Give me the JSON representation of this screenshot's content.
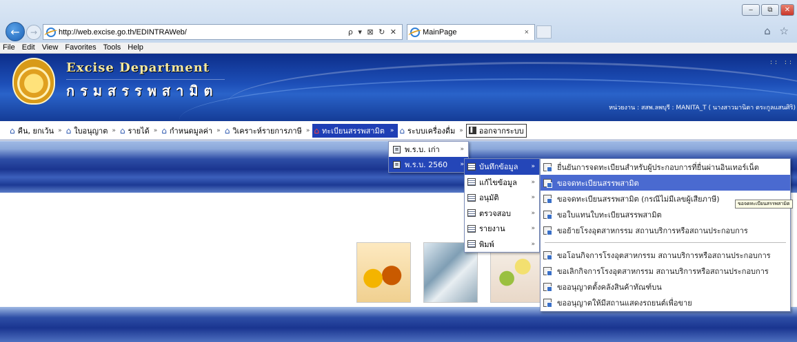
{
  "browser": {
    "url": "http://web.excise.go.th/EDINTRAWeb/",
    "url_tools": "ρ ▾ ⊠ ↻ ✕",
    "tab_title": "MainPage",
    "tab_close": "×",
    "caption_buttons": [
      "‒",
      "⧉",
      "✕"
    ],
    "toolbar_icons": "⌂ ☆"
  },
  "menubar": [
    "File",
    "Edit",
    "View",
    "Favorites",
    "Tools",
    "Help"
  ],
  "banner": {
    "title_en": "Excise Department",
    "title_th": "กรมสรรพสามิต",
    "user_info": "หน่วยงาน : สสพ.ลพบุรี : MANITA_T ( นางสาวมานิตา ตระกูลแสนศิริ)",
    "dots": ":: ::"
  },
  "main_menu": [
    {
      "label": "คืน, ยกเว้น"
    },
    {
      "label": "ใบอนุญาต"
    },
    {
      "label": "รายได้"
    },
    {
      "label": "กำหนดมูลค่า"
    },
    {
      "label": "วิเคราะห์รายการภาษี"
    },
    {
      "label": "ทะเบียนสรรพสามิต"
    },
    {
      "label": "ระบบเครื่องดื่ม"
    },
    {
      "label": "ออกจากระบบ"
    }
  ],
  "menu_separator": "»",
  "active_separator": "»",
  "submenu1": [
    {
      "label": "พ.ร.บ. เก่า"
    },
    {
      "label": "พ.ร.บ. 2560"
    }
  ],
  "submenu2": [
    {
      "label": "บันทึกข้อมูล"
    },
    {
      "label": "แก้ไขข้อมูล"
    },
    {
      "label": "อนุมัติ"
    },
    {
      "label": "ตรวจสอบ"
    },
    {
      "label": "รายงาน"
    },
    {
      "label": "พิมพ์"
    }
  ],
  "submenu3": [
    {
      "label": "ยื่นยันการจดทะเบียนสำหรับผู้ประกอบการที่ยื่นผ่านอินเทอร์เน็ต"
    },
    {
      "label": "ขอจดทะเบียนสรรพสามิต"
    },
    {
      "label": "ขอจดทะเบียนสรรพสามิต (กรณีไม่มีเลขผู้เสียภาษี)"
    },
    {
      "label": "ขอใบแทนใบทะเบียนสรรพสามิต"
    },
    {
      "label": "ขอย้ายโรงอุตสาหกรรม สถานบริการหรือสถานประกอบการ"
    },
    {
      "label": "ขอโอนกิจการโรงอุตสาหกรรม สถานบริการหรือสถานประกอบการ"
    },
    {
      "label": "ขอเลิกกิจการโรงอุตสาหกรรม สถานบริการหรือสถานประกอบการ"
    },
    {
      "label": "ขออนุญาตตั้งคลังสินค้าทัณฑ์บน"
    },
    {
      "label": "ขออนุญาตให้มีสถานแสดงรถยนต์เพื่อขาย"
    }
  ],
  "tooltip": "ขอจดทะเบียนสรรพสามิต",
  "arrow": "»"
}
